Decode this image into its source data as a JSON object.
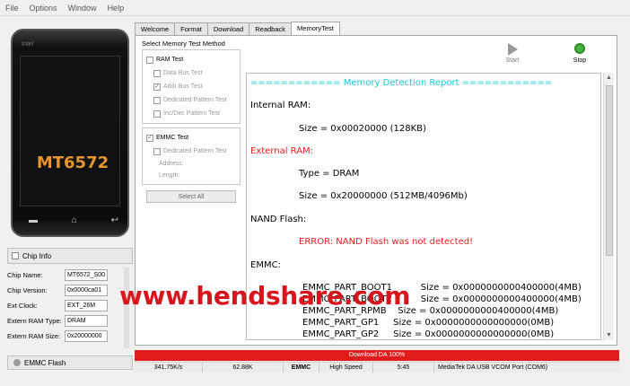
{
  "menu": [
    "File",
    "Options",
    "Window",
    "Help"
  ],
  "phone": {
    "brand": "Intel",
    "model": "MT6572"
  },
  "chip_info": {
    "title": "Chip Info",
    "rows": [
      {
        "label": "Chip Name:",
        "value": "MT6572_S00"
      },
      {
        "label": "Chip Version:",
        "value": "0x0000ca01"
      },
      {
        "label": "Ext Clock:",
        "value": "EXT_26M"
      },
      {
        "label": "Extern RAM Type:",
        "value": "DRAM"
      },
      {
        "label": "Extern RAM Size:",
        "value": "0x20000000"
      }
    ]
  },
  "emmc_flash": "EMMC Flash",
  "tabs": [
    "Welcome",
    "Format",
    "Download",
    "Readback",
    "MemoryTest"
  ],
  "memory_test_method": {
    "title": "Select Memory Test Method",
    "ram_test": "RAM Test",
    "ram_items": [
      "Data Bus Test",
      "Addr Bus Test",
      "Dedicated Pattern Test",
      "Inc/Dec Pattern Test"
    ],
    "ram_checked": [
      false,
      true,
      false,
      false
    ],
    "emmc_test": "EMMC Test",
    "emmc_items": [
      "Dedicated Pattern Test"
    ],
    "address_label": "Address:",
    "length_label": "Length:",
    "select_all": "Select All"
  },
  "toolbar": {
    "start": "Start",
    "stop": "Stop"
  },
  "report": {
    "header": "============ Memory Detection Report ============",
    "internal_ram": "Internal RAM:",
    "internal_size": "Size = 0x00020000 (128KB)",
    "external_ram": "External RAM:",
    "external_type": "Type = DRAM",
    "external_size": "Size = 0x20000000 (512MB/4096Mb)",
    "nand_flash": "NAND Flash:",
    "nand_error": "ERROR: NAND Flash was not detected!",
    "emmc": "EMMC:",
    "emmc_lines": [
      "EMMC_PART_BOOT1          Size = 0x0000000000400000(4MB)",
      "EMMC_PART_BOOT2          Size = 0x0000000000400000(4MB)",
      "EMMC_PART_RPMB    Size = 0x0000000000400000(4MB)",
      "EMMC_PART_GP1     Size = 0x0000000000000000(0MB)",
      "EMMC_PART_GP2     Size = 0x0000000000000000(0MB)"
    ]
  },
  "watermark": "www.hendshare.com",
  "progress_text": "Download DA 100%",
  "status": {
    "speed": "341.75K/s",
    "size": "62.88K",
    "storage": "EMMC",
    "usb_speed": "High Speed",
    "time": "5:45",
    "port": "MediaTek DA USB VCOM Port (COM6)"
  },
  "colors": {
    "accent_cyan": "#19c8d8",
    "error_red": "#e02020",
    "progress_red": "#e21c1c",
    "chip_orange": "#e8942c"
  }
}
